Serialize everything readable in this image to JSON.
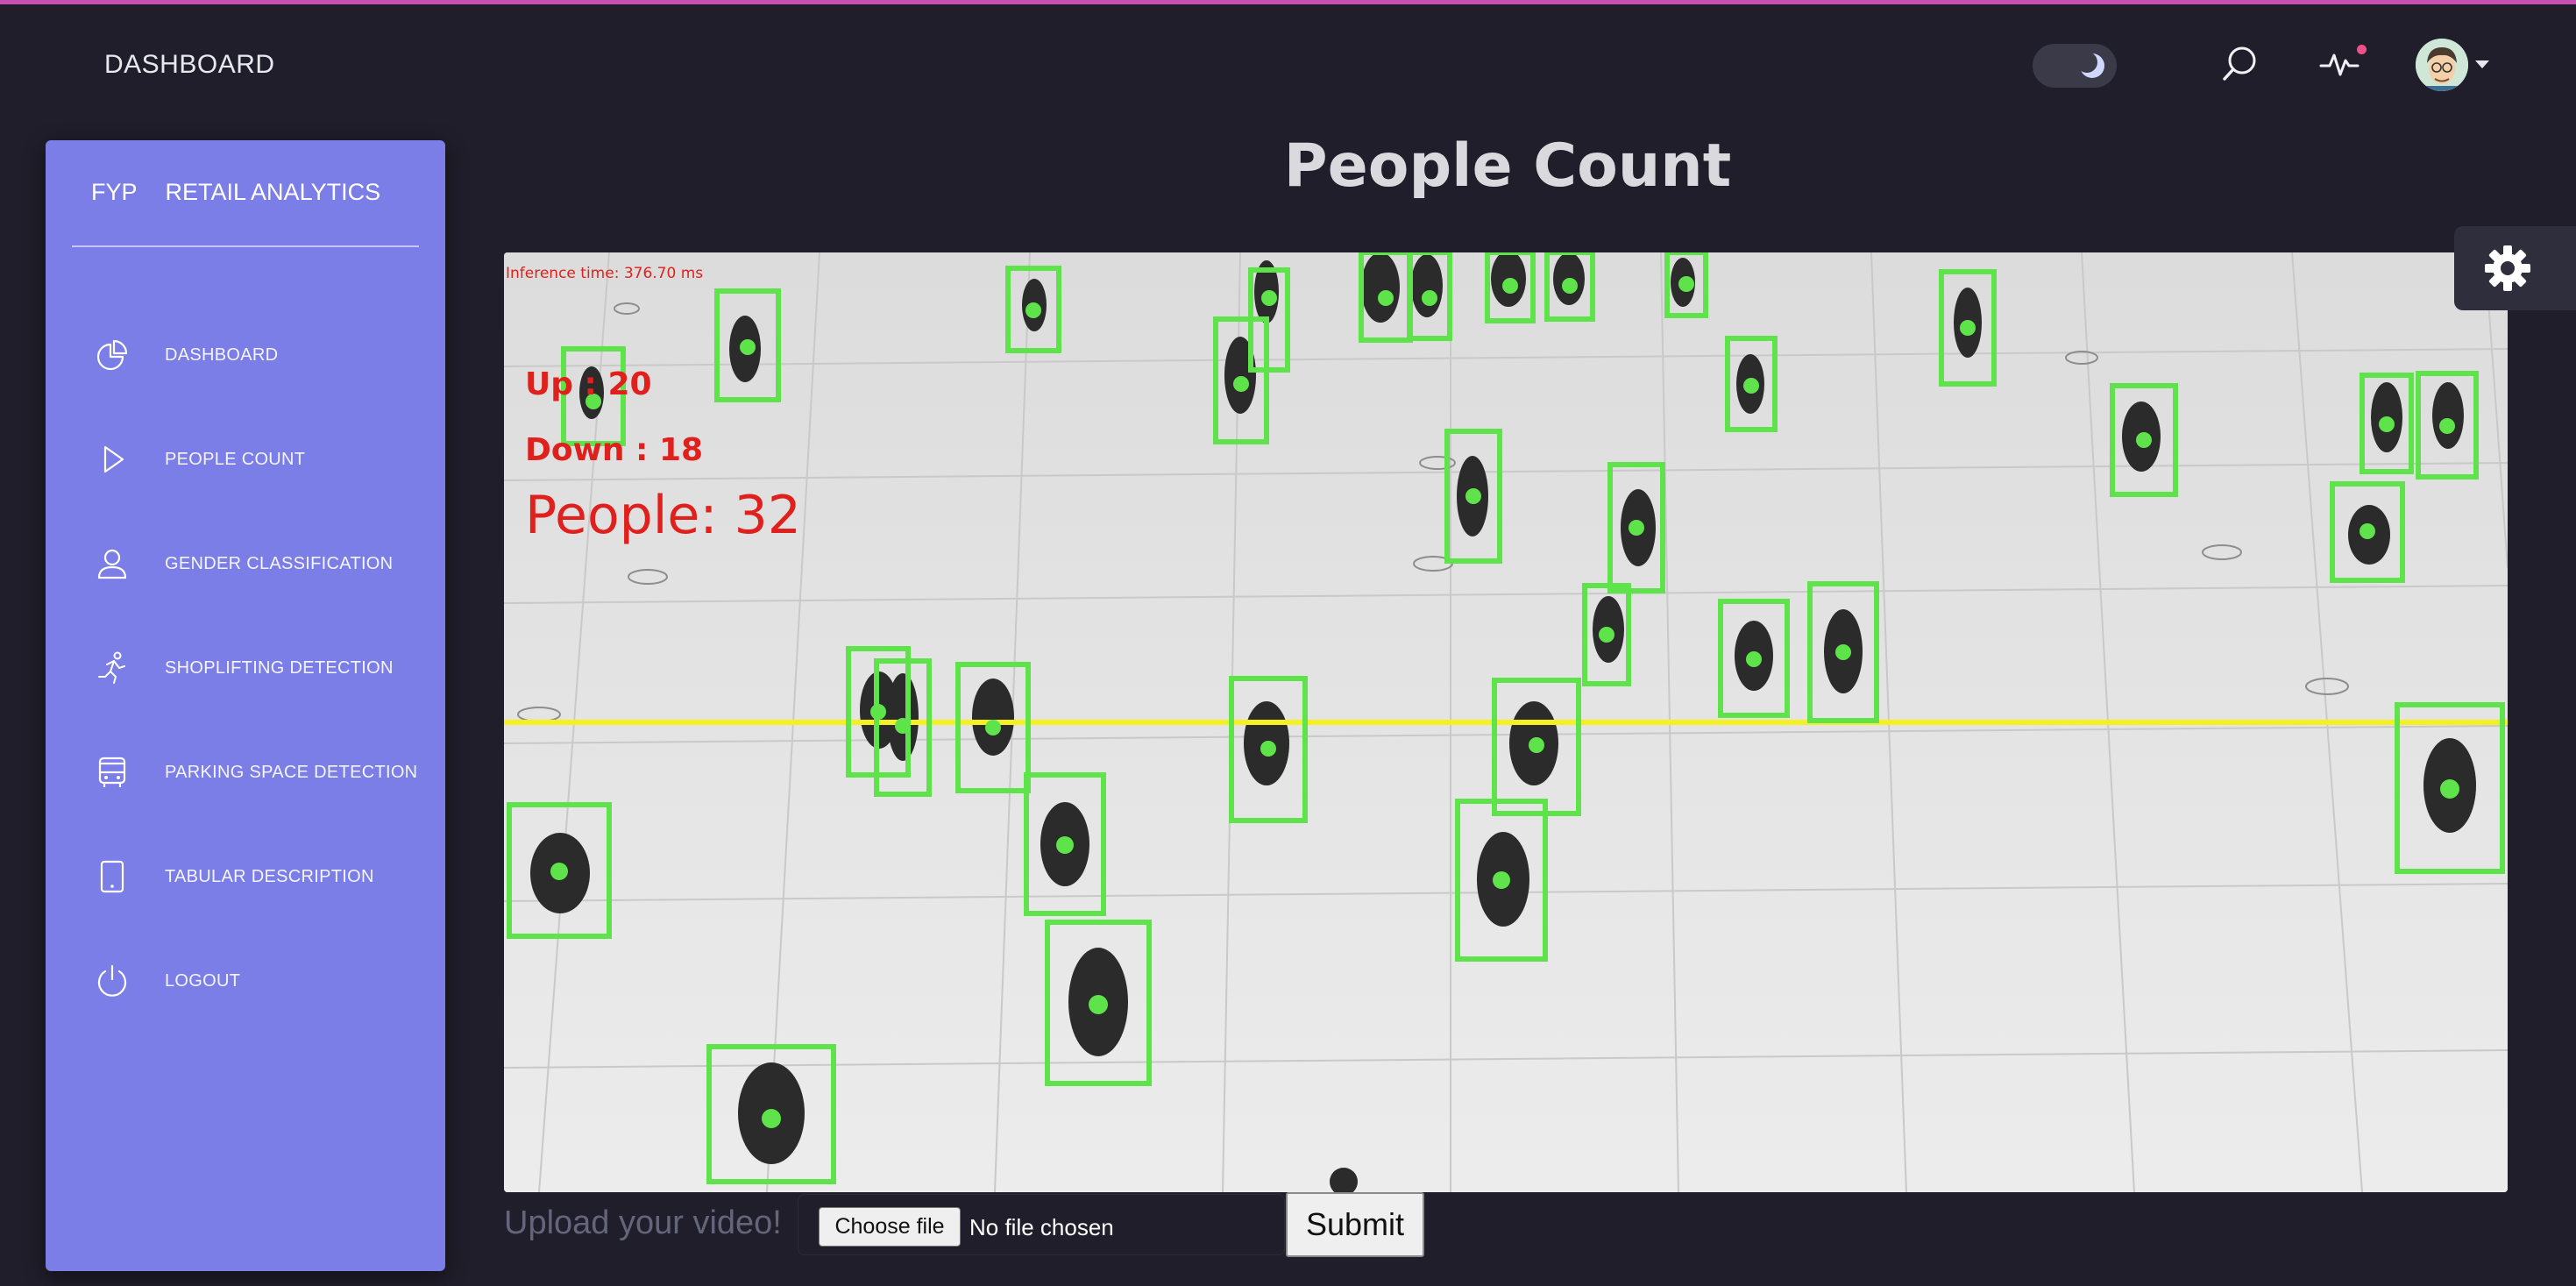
{
  "header": {
    "title": "DASHBOARD"
  },
  "sidebar": {
    "brand_short": "FYP",
    "brand_name": "RETAIL ANALYTICS",
    "items": [
      {
        "label": "DASHBOARD",
        "icon": "pie-chart-icon"
      },
      {
        "label": "PEOPLE COUNT",
        "icon": "play-icon"
      },
      {
        "label": "GENDER CLASSIFICATION",
        "icon": "user-icon"
      },
      {
        "label": "SHOPLIFTING DETECTION",
        "icon": "running-person-icon"
      },
      {
        "label": "PARKING SPACE DETECTION",
        "icon": "bus-icon"
      },
      {
        "label": "TABULAR DESCRIPTION",
        "icon": "tablet-icon"
      },
      {
        "label": "LOGOUT",
        "icon": "power-icon"
      }
    ]
  },
  "main": {
    "title": "People Count",
    "video": {
      "inference_text": "Inference time: 376.70 ms",
      "up_text": "Up : 20",
      "down_text": "Down : 18",
      "people_text": "People:  32"
    },
    "upload": {
      "label": "Upload your video!",
      "choose_button": "Choose file",
      "file_status": "No file chosen",
      "submit_button": "Submit"
    }
  },
  "colors": {
    "background": "#1f1e2a",
    "sidebar": "#7b7ee6",
    "accent": "#c94fb3",
    "detection_box": "#5fe34a",
    "counting_line": "#f3f023",
    "overlay_text": "#e0201c"
  }
}
